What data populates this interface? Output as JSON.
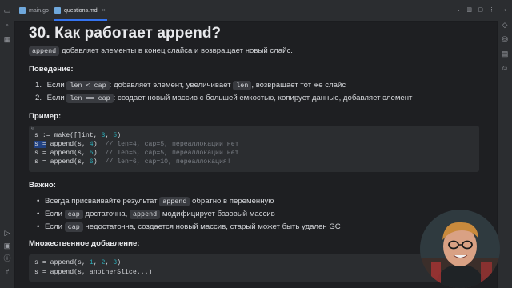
{
  "tabs": [
    {
      "label": "main.go",
      "icon_color": "#6fa8dc"
    },
    {
      "label": "questions.md",
      "icon_color": "#6fa8dc"
    }
  ],
  "tab_close_glyph": "×",
  "title": "30. Как работает append?",
  "intro": {
    "code": "append",
    "text": "добавляет элементы в конец слайса и возвращает новый слайс."
  },
  "behavior": {
    "heading": "Поведение:",
    "items": [
      {
        "num": "1.",
        "pre": "Если",
        "code": "len < cap",
        "text": ": добавляет элемент, увеличивает",
        "code2": "len",
        "text2": ", возвращает тот же слайс"
      },
      {
        "num": "2.",
        "pre": "Если",
        "code": "len == cap",
        "text": ": создает новый массив с большей емкостью, копирует данные, добавляет элемент"
      }
    ]
  },
  "example": {
    "heading": "Пример:",
    "marker": "↯",
    "lines": [
      {
        "code": "s := make([]int, ",
        "n1": "3",
        "sep": ", ",
        "n2": "5",
        "end": ")",
        "comment": ""
      },
      {
        "sel": "s =",
        "code": " append(s, ",
        "n1": "4",
        "end": ")",
        "comment": "// len=4, cap=5, переаллокации нет"
      },
      {
        "code": "s = append(s, ",
        "n1": "5",
        "end": ")",
        "comment": "// len=5, cap=5, переаллокации нет"
      },
      {
        "code": "s = append(s, ",
        "n1": "6",
        "end": ")",
        "comment": "// len=6, cap=10, переаллокация!"
      }
    ]
  },
  "important": {
    "heading": "Важно:",
    "items": [
      {
        "pre": "Всегда присваивайте результат",
        "code": "append",
        "text": "обратно в переменную"
      },
      {
        "pre": "Если",
        "code": "cap",
        "mid": "достаточна,",
        "code2": "append",
        "text": "модифицирует базовый массив"
      },
      {
        "pre": "Если",
        "code": "cap",
        "text": "недостаточна, создается новый массив, старый может быть удален GC"
      }
    ]
  },
  "multi": {
    "heading": "Множественное добавление:",
    "lines": [
      {
        "code": "s = append(s, ",
        "n1": "1",
        "sep1": ", ",
        "n2": "2",
        "sep2": ", ",
        "n3": "3",
        "end": ")"
      },
      {
        "code": "s = append(s, anotherSlice...)"
      }
    ]
  },
  "colors": {
    "accent": "#3574f0",
    "background": "#1e1f22",
    "panel": "#2b2d30",
    "number": "#2aacb8",
    "comment": "#7a7e85"
  }
}
